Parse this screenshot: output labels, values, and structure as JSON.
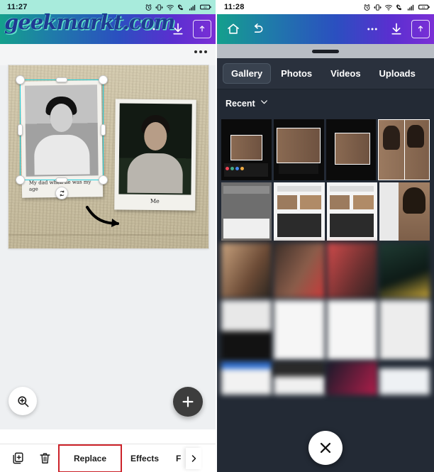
{
  "left_panel": {
    "status_bar": {
      "time": "11:27",
      "icons": [
        "alarm-icon",
        "vibrate-icon",
        "wifi-icon",
        "call-icon",
        "signal-icon",
        "battery-icon"
      ]
    },
    "watermark": "geekmarkt.com",
    "app_bar": {
      "icons": [
        "more-options-icon",
        "download-icon",
        "share-icon"
      ]
    },
    "canvas": {
      "overflow_menu": "more-options-icon",
      "polaroids": [
        {
          "caption": "My dad when he was my age",
          "selected": true
        },
        {
          "caption": "Me",
          "selected": false
        }
      ],
      "selection": {
        "handle_color": "#23d2e0",
        "rotate_handle": "rotate-icon"
      },
      "zoom_button": "zoom-in-icon",
      "add_button": "plus-icon"
    },
    "bottom_toolbar": {
      "icons": [
        "duplicate-icon",
        "delete-icon"
      ],
      "items": [
        {
          "label": "Replace",
          "highlighted": true
        },
        {
          "label": "Effects",
          "highlighted": false
        },
        {
          "label": "F",
          "highlighted": false
        }
      ],
      "next_arrow": "chevron-right-icon",
      "highlight_color": "#cc2229"
    }
  },
  "right_panel": {
    "status_bar": {
      "time": "11:28",
      "icons": [
        "alarm-icon",
        "vibrate-icon",
        "wifi-icon",
        "call-icon",
        "signal-icon",
        "battery-icon"
      ]
    },
    "app_bar": {
      "left_icons": [
        "home-icon",
        "undo-icon"
      ],
      "right_icons": [
        "more-options-icon",
        "download-icon",
        "share-icon"
      ]
    },
    "sheet": {
      "grip": "drag-handle",
      "tabs": [
        {
          "label": "Gallery",
          "active": true
        },
        {
          "label": "Photos",
          "active": false
        },
        {
          "label": "Videos",
          "active": false
        },
        {
          "label": "Uploads",
          "active": false
        }
      ],
      "filter": {
        "label": "Recent",
        "chevron": "chevron-down-icon"
      },
      "selected_thumbnail_outline": "#e02020",
      "close_button": "close-icon"
    }
  },
  "theme": {
    "gradient_start": "#14a08c",
    "gradient_end": "#7b2fd6",
    "sheet_background": "#232a35",
    "selection_cyan": "#23d2e0",
    "red_highlight": "#cc2229",
    "artboard_tan": "#cfc4a4"
  }
}
